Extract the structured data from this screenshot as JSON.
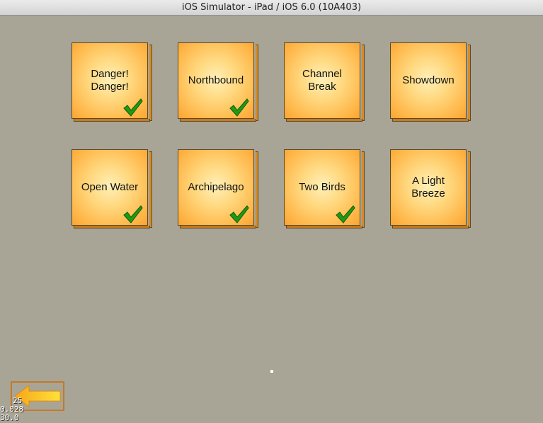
{
  "window": {
    "title": "iOS Simulator - iPad / iOS 6.0 (10A403)"
  },
  "levels": [
    {
      "label": "Danger!\nDanger!",
      "completed": true
    },
    {
      "label": "Northbound",
      "completed": true
    },
    {
      "label": "Channel\nBreak",
      "completed": false
    },
    {
      "label": "Showdown",
      "completed": false
    },
    {
      "label": "Open Water",
      "completed": true
    },
    {
      "label": "Archipelago",
      "completed": true
    },
    {
      "label": "Two Birds",
      "completed": true
    },
    {
      "label": "A Light\nBreeze",
      "completed": false
    }
  ],
  "icons": {
    "check": "checkmark-icon",
    "back": "back-arrow-icon"
  },
  "colors": {
    "background": "#a8a597",
    "tile": "#ffc45e",
    "check": "#1f9a12",
    "back_arrow": "#f4b41a"
  },
  "debug": {
    "nodes": "25",
    "frame_time": "0.028",
    "fps": "30.0"
  }
}
